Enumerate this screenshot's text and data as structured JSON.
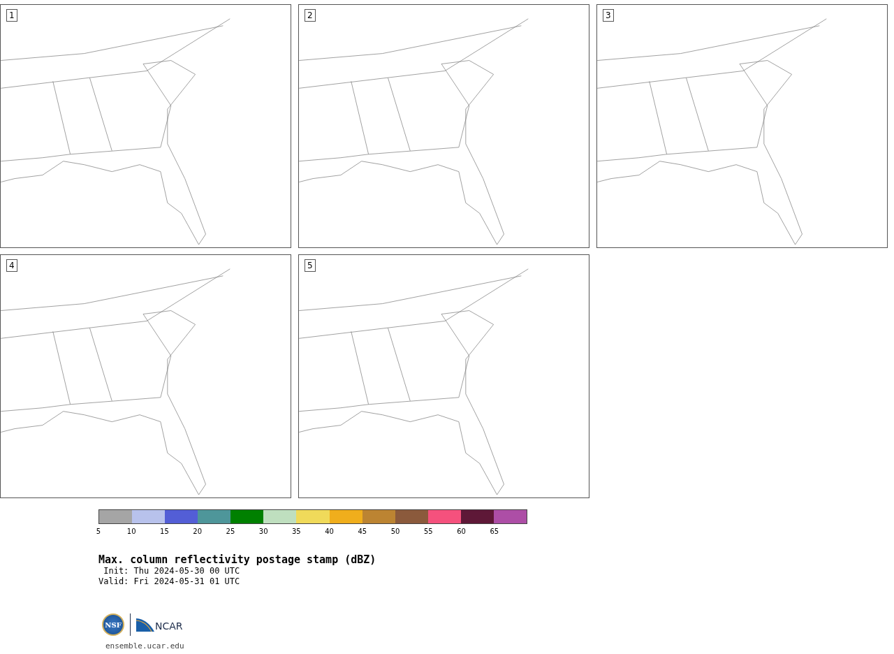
{
  "panels": [
    {
      "label": "1"
    },
    {
      "label": "2"
    },
    {
      "label": "3"
    },
    {
      "label": "4"
    },
    {
      "label": "5"
    }
  ],
  "colorbar": {
    "segments": [
      {
        "color": "#a5a5a5"
      },
      {
        "color": "#b8c2ec"
      },
      {
        "color": "#535ed6"
      },
      {
        "color": "#4e969a"
      },
      {
        "color": "#008000"
      },
      {
        "color": "#bfdfbf"
      },
      {
        "color": "#f0da5a"
      },
      {
        "color": "#f0ae1c"
      },
      {
        "color": "#bc8432"
      },
      {
        "color": "#8b5a3c"
      },
      {
        "color": "#f5517d"
      },
      {
        "color": "#5e1837"
      },
      {
        "color": "#ad4ea6"
      }
    ],
    "ticks": [
      "5",
      "10",
      "15",
      "20",
      "25",
      "30",
      "35",
      "40",
      "45",
      "50",
      "55",
      "60",
      "65"
    ]
  },
  "title": "Max. column reflectivity postage stamp (dBZ)",
  "init": " Init: Thu 2024-05-30 00 UTC",
  "valid": "Valid: Fri 2024-05-31 01 UTC",
  "logo": {
    "nsf": "NSF",
    "ncar": "NCAR"
  },
  "url": "ensemble.ucar.edu"
}
